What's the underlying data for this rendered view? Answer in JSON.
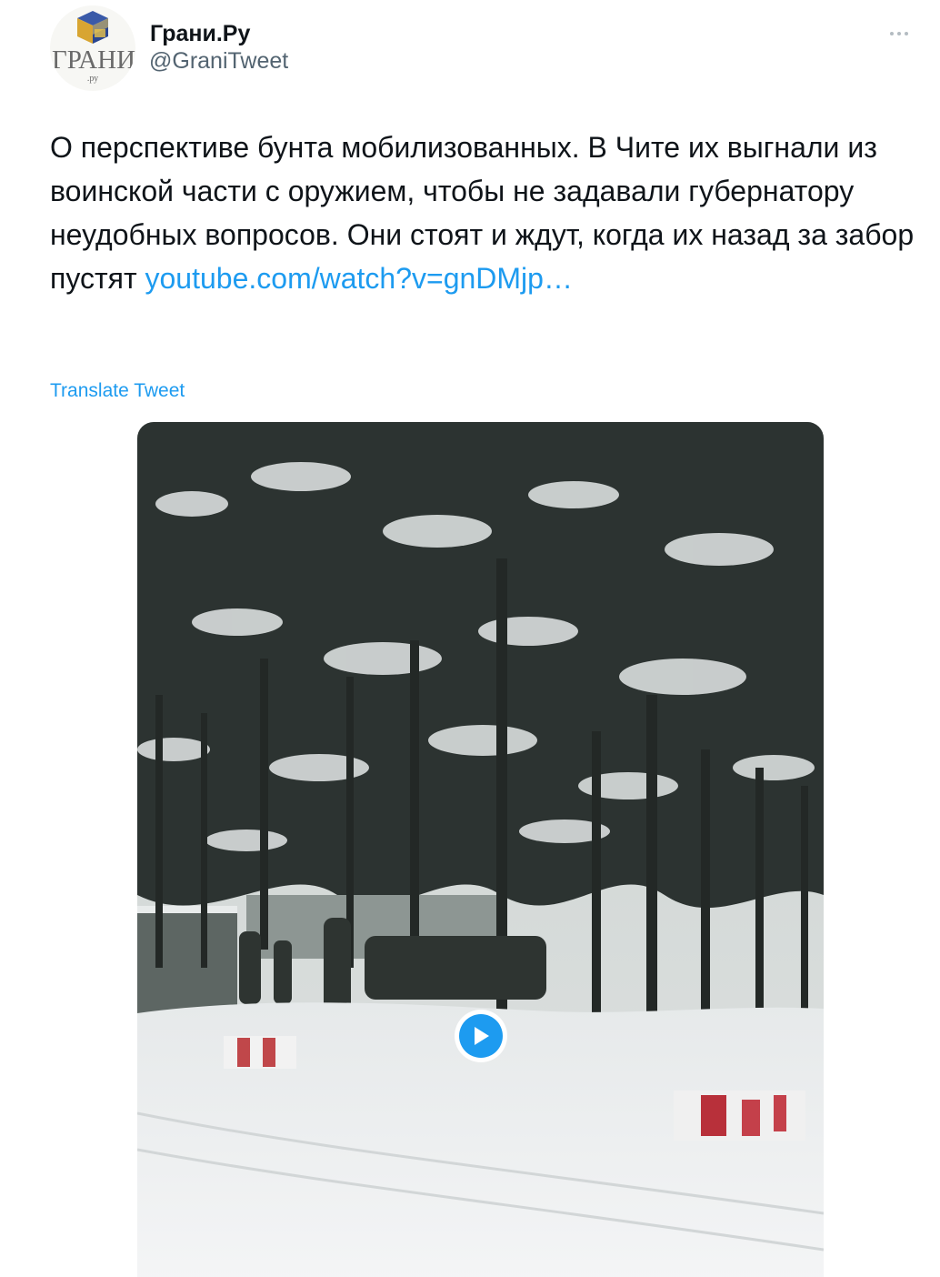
{
  "author": {
    "display_name": "Грани.Ру",
    "handle": "@GraniTweet",
    "avatar": {
      "logo_text": "ГРАНИ",
      "logo_subtext": ".ру",
      "icon": "grani-cube-logo"
    }
  },
  "tweet": {
    "text": "О перспективе бунта мобилизованных. В Чите их выгнали из воинской части с оружием, чтобы не задавали губернатору неудобных вопросов. Они стоят и ждут, когда их назад за забор пустят ",
    "link_text": "youtube.com/​watch?v=gnDMjp…",
    "translate_label": "Translate Tweet"
  },
  "media": {
    "type": "video",
    "description_icon": "play-icon"
  },
  "colors": {
    "accent": "#1d9bf0",
    "secondary_text": "#536471",
    "primary_text": "#0f1419"
  }
}
